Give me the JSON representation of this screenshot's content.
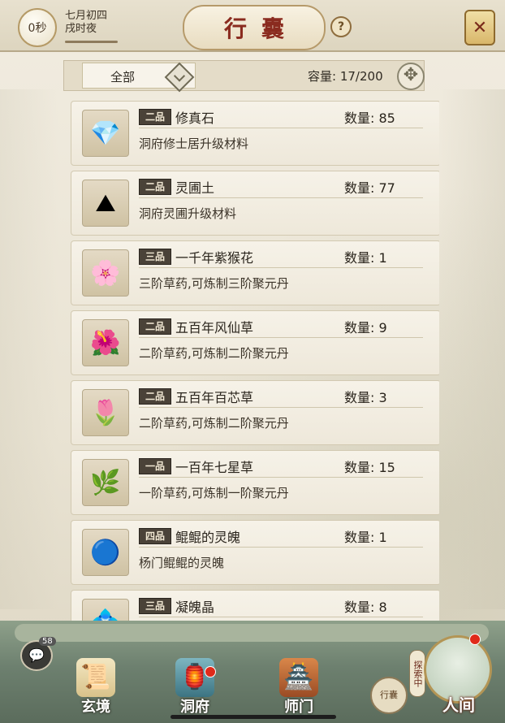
{
  "header": {
    "timer": "0秒",
    "date_line1": "七月初四",
    "date_line2": "戌时夜",
    "title": "行囊",
    "help_symbol": "?"
  },
  "filter": {
    "selected": "全部",
    "capacity_label": "容量:",
    "capacity_value": "17/200"
  },
  "items": [
    {
      "grade": "二品",
      "name": "修真石",
      "qty_label": "数量:",
      "qty": "85",
      "desc": "洞府修士居升级材料",
      "icon": "crystal-icon",
      "glyph": "💎"
    },
    {
      "grade": "二品",
      "name": "灵圃土",
      "qty_label": "数量:",
      "qty": "77",
      "desc": "洞府灵圃升级材料",
      "icon": "soil-icon",
      "glyph": "⛰"
    },
    {
      "grade": "三品",
      "name": "一千年紫猴花",
      "qty_label": "数量:",
      "qty": "1",
      "desc": "三阶草药,可炼制三阶聚元丹",
      "icon": "purple-flower-icon",
      "glyph": "🌸"
    },
    {
      "grade": "二品",
      "name": "五百年风仙草",
      "qty_label": "数量:",
      "qty": "9",
      "desc": "二阶草药,可炼制二阶聚元丹",
      "icon": "red-flower-icon",
      "glyph": "🌺"
    },
    {
      "grade": "二品",
      "name": "五百年百芯草",
      "qty_label": "数量:",
      "qty": "3",
      "desc": "二阶草药,可炼制二阶聚元丹",
      "icon": "bellflower-icon",
      "glyph": "🌷"
    },
    {
      "grade": "一品",
      "name": "一百年七星草",
      "qty_label": "数量:",
      "qty": "15",
      "desc": "一阶草药,可炼制一阶聚元丹",
      "icon": "herb-icon",
      "glyph": "🌿"
    },
    {
      "grade": "四品",
      "name": "鲲鲲的灵魄",
      "qty_label": "数量:",
      "qty": "1",
      "desc": "杨门鲲鲲的灵魄",
      "icon": "blue-orb-icon",
      "glyph": "🔵"
    },
    {
      "grade": "三品",
      "name": "凝魄晶",
      "qty_label": "数量:",
      "qty": "8",
      "desc": "",
      "icon": "purple-crystal-icon",
      "glyph": "💠"
    }
  ],
  "bottom_nav": {
    "chat_badge": "58",
    "xuanjing": "玄境",
    "dongfu": "洞府",
    "shimen": "师门",
    "bag": "行囊",
    "explore": "探索中",
    "renjian": "人间"
  }
}
